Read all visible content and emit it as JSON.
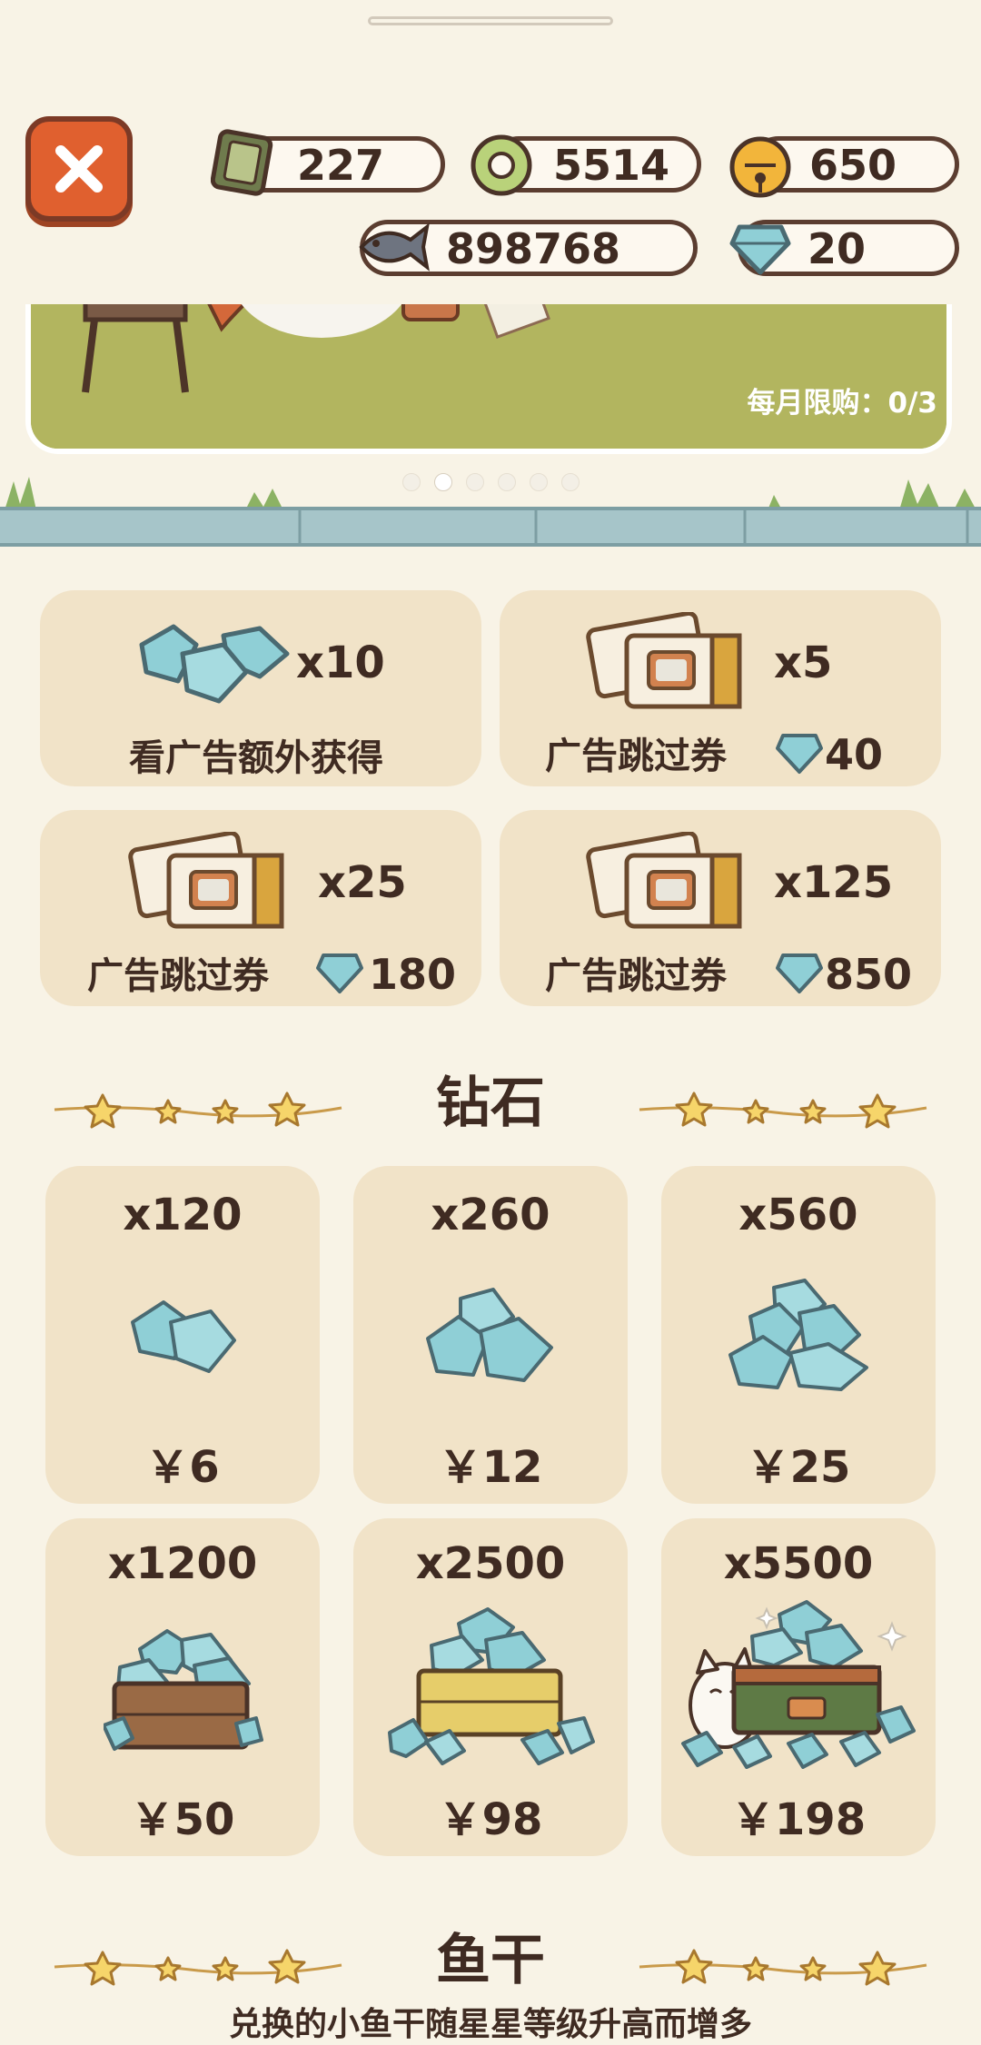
{
  "currencies": {
    "ad_tickets": "227",
    "coins": "5514",
    "bells": "650",
    "fish": "898768",
    "diamonds": "20"
  },
  "banner": {
    "monthly_limit": "每月限购：0/3",
    "dot_count": 6,
    "active_dot": 2
  },
  "offers": [
    {
      "qty": "x10",
      "label": "看广告额外获得",
      "price": ""
    },
    {
      "qty": "x5",
      "label": "广告跳过券",
      "price": "40"
    },
    {
      "qty": "x25",
      "label": "广告跳过券",
      "price": "180"
    },
    {
      "qty": "x125",
      "label": "广告跳过券",
      "price": "850"
    }
  ],
  "diamond_section": {
    "title": "钻石",
    "packs": [
      {
        "qty": "x120",
        "price": "￥6"
      },
      {
        "qty": "x260",
        "price": "￥12"
      },
      {
        "qty": "x560",
        "price": "￥25"
      },
      {
        "qty": "x1200",
        "price": "￥50"
      },
      {
        "qty": "x2500",
        "price": "￥98"
      },
      {
        "qty": "x5500",
        "price": "￥198"
      }
    ]
  },
  "fish_section": {
    "title": "鱼干",
    "subtitle": "兑换的小鱼干随星星等级升高而增多"
  },
  "colors": {
    "background": "#f8f3e6",
    "card": "#f1e3c8",
    "diamond": "#8fcfd6",
    "close_button": "#e0602f",
    "text": "#3f2b22"
  }
}
